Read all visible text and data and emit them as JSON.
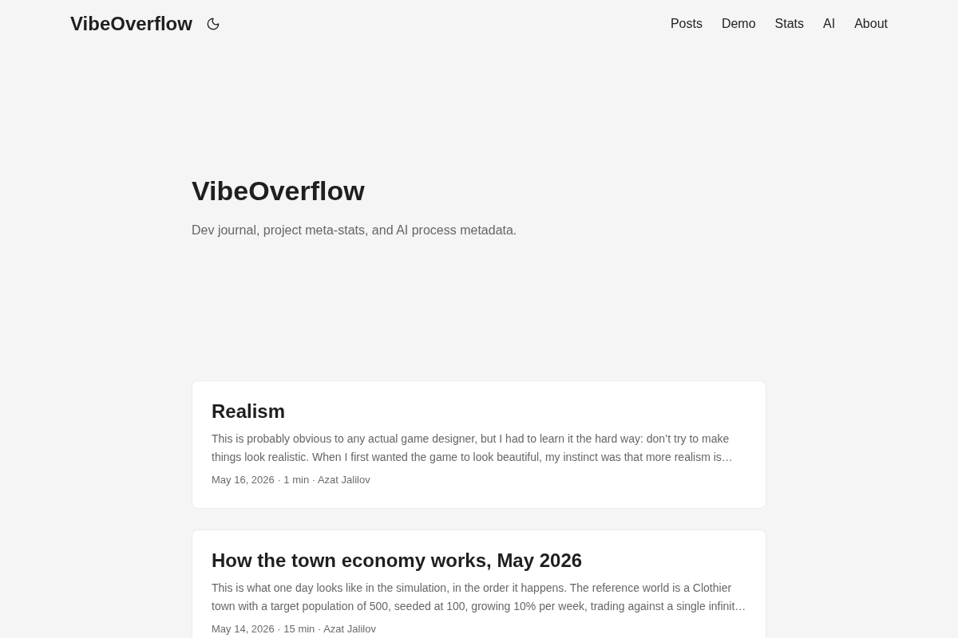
{
  "header": {
    "logo": "VibeOverflow",
    "nav": [
      "Posts",
      "Demo",
      "Stats",
      "AI",
      "About"
    ]
  },
  "hero": {
    "title": "VibeOverflow",
    "subtitle": "Dev journal, project meta-stats, and AI process metadata."
  },
  "posts": [
    {
      "title": "Realism",
      "excerpt": "This is probably obvious to any actual game designer, but I had to learn it the hard way: don’t try to make things look realistic. When I first wanted the game to look beautiful, my instinct was that more realism is…",
      "meta": "May 16, 2026 · 1 min · Azat Jalilov"
    },
    {
      "title": "How the town economy works, May 2026",
      "excerpt": "This is what one day looks like in the simulation, in the order it happens. The reference world is a Clothier town with a target population of 500, seeded at 100, growing 10% per week, trading against a single infinit…",
      "meta": "May 14, 2026 · 15 min · Azat Jalilov"
    }
  ]
}
